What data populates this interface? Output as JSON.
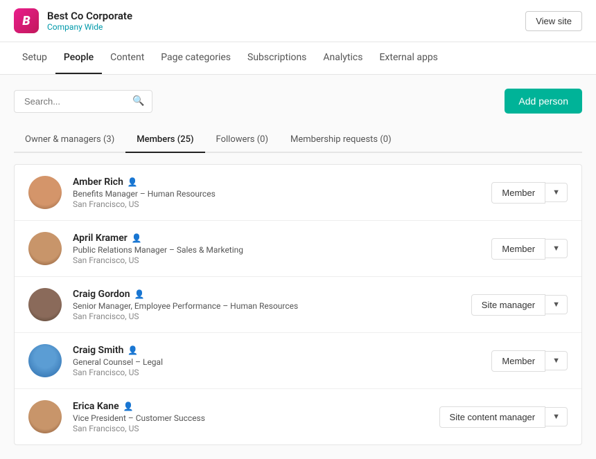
{
  "header": {
    "logo_letter": "B",
    "company_name": "Best Co Corporate",
    "company_sub": "Company Wide",
    "view_site_label": "View site"
  },
  "nav": {
    "items": [
      {
        "id": "setup",
        "label": "Setup",
        "active": false
      },
      {
        "id": "people",
        "label": "People",
        "active": true
      },
      {
        "id": "content",
        "label": "Content",
        "active": false
      },
      {
        "id": "page-categories",
        "label": "Page categories",
        "active": false
      },
      {
        "id": "subscriptions",
        "label": "Subscriptions",
        "active": false
      },
      {
        "id": "analytics",
        "label": "Analytics",
        "active": false
      },
      {
        "id": "external-apps",
        "label": "External apps",
        "active": false
      }
    ]
  },
  "toolbar": {
    "search_placeholder": "Search...",
    "add_person_label": "Add person"
  },
  "tabs": [
    {
      "id": "owners",
      "label": "Owner & managers (3)",
      "active": false
    },
    {
      "id": "members",
      "label": "Members (25)",
      "active": true
    },
    {
      "id": "followers",
      "label": "Followers (0)",
      "active": false
    },
    {
      "id": "membership-requests",
      "label": "Membership requests (0)",
      "active": false
    }
  ],
  "people": [
    {
      "id": "amber-rich",
      "name": "Amber Rich",
      "role": "Benefits Manager – Human Resources",
      "location": "San Francisco, US",
      "membership": "Member",
      "avatar_class": "face-amber"
    },
    {
      "id": "april-kramer",
      "name": "April Kramer",
      "role": "Public Relations Manager – Sales & Marketing",
      "location": "San Francisco, US",
      "membership": "Member",
      "avatar_class": "face-april"
    },
    {
      "id": "craig-gordon",
      "name": "Craig Gordon",
      "role": "Senior Manager, Employee Performance – Human Resources",
      "location": "San Francisco, US",
      "membership": "Site manager",
      "avatar_class": "face-craig-g"
    },
    {
      "id": "craig-smith",
      "name": "Craig Smith",
      "role": "General Counsel – Legal",
      "location": "San Francisco, US",
      "membership": "Member",
      "avatar_class": "face-craig-s"
    },
    {
      "id": "erica-kane",
      "name": "Erica Kane",
      "role": "Vice President – Customer Success",
      "location": "San Francisco, US",
      "membership": "Site content manager",
      "avatar_class": "face-erica"
    }
  ],
  "icons": {
    "search": "🔍",
    "person": "👤",
    "chevron_down": "▾"
  }
}
